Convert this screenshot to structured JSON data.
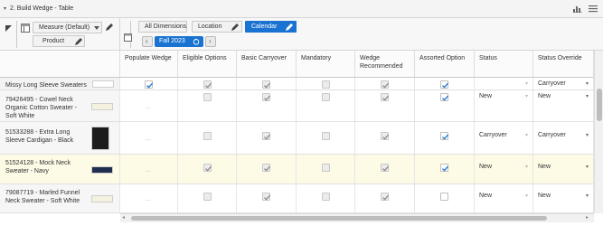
{
  "window": {
    "title": "2. Build Wedge - Table"
  },
  "toolbar": {
    "measure_label": "Measure (Default)",
    "product_label": "Product",
    "all_dimensions_label": "All Dimensions",
    "location_label": "Location",
    "calendar_label": "Calendar",
    "period_label": "Fall 2023"
  },
  "columns": [
    "Populate Wedge",
    "Eligible Options",
    "Basic Carryover",
    "Mandatory",
    "Wedge Recommended",
    "Assorted Option",
    "Status",
    "Status Override"
  ],
  "rows": [
    {
      "label": "Missy Long Sleeve Sweaters",
      "swatch": "",
      "values": [
        "checked",
        "checked-dis",
        "checked-dis",
        "empty-dis",
        "checked-dis",
        "checked",
        "",
        "Carryover"
      ],
      "status": "",
      "override": "Carryover"
    },
    {
      "label": "79426495 - Cowel Neck Organic Cotton Sweater - Soft White",
      "swatch": "#f4f1df",
      "values": [
        "dash",
        "empty-dis",
        "checked-dis",
        "empty-dis",
        "checked-dis",
        "checked",
        "New",
        "New"
      ],
      "status": "New",
      "override": "New"
    },
    {
      "label": "51533288 - Extra Long Sleeve Cardigan - Black",
      "swatch": "#1c1c1c",
      "values": [
        "dash",
        "empty-dis",
        "checked-dis",
        "empty-dis",
        "checked-dis",
        "checked",
        "Carryover",
        "Carryover"
      ],
      "status": "Carryover",
      "override": "Carryover"
    },
    {
      "label": "51524128 - Mock Neck Sweater - Navy",
      "swatch": "#1f2d4f",
      "values": [
        "dash",
        "checked-dis",
        "checked-dis",
        "empty-dis",
        "checked-dis",
        "checked",
        "New",
        "New"
      ],
      "status": "New",
      "override": "New"
    },
    {
      "label": "79087719 - Marled Funnel Neck Sweater - Soft White",
      "swatch": "#f4f1df",
      "values": [
        "dash",
        "empty-dis",
        "checked-dis",
        "empty-dis",
        "checked-dis",
        "empty",
        "New",
        "New"
      ],
      "status": "New",
      "override": "New"
    }
  ],
  "colors": {
    "accent": "#1b73d1",
    "highlight_row": "#fdfae5",
    "check": "#1b73d1"
  },
  "icons": [
    "collapse-caret-icon",
    "chart-icon",
    "menu-icon",
    "table-icon",
    "edit-pencil-icon",
    "dropdown-arrow-icon",
    "reset-icon",
    "prev-arrow-icon",
    "next-arrow-icon",
    "row-expand-icon"
  ]
}
